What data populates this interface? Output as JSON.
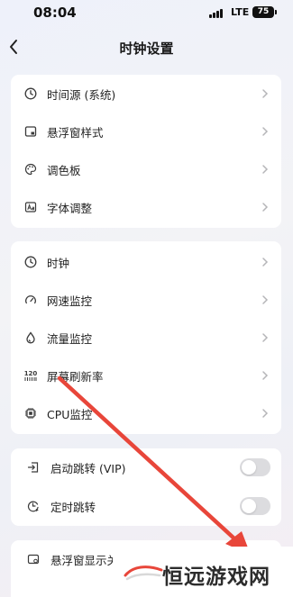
{
  "status_bar": {
    "time": "08:04",
    "network": "LTE",
    "battery": "75"
  },
  "header": {
    "title": "时钟设置"
  },
  "card1": {
    "items": [
      {
        "label": "时间源 (系统)",
        "icon": "clock-icon"
      },
      {
        "label": "悬浮窗样式",
        "icon": "window-icon"
      },
      {
        "label": "调色板",
        "icon": "palette-icon"
      },
      {
        "label": "字体调整",
        "icon": "font-icon"
      }
    ]
  },
  "card2": {
    "items": [
      {
        "label": "时钟",
        "icon": "clock-icon"
      },
      {
        "label": "网速监控",
        "icon": "speedometer-icon"
      },
      {
        "label": "流量监控",
        "icon": "droplet-icon"
      },
      {
        "label": "屏幕刷新率",
        "icon": "refresh-rate-icon",
        "icon_text": "120"
      },
      {
        "label": "CPU监控",
        "icon": "cpu-icon"
      }
    ]
  },
  "card3": {
    "items": [
      {
        "label": "启动跳转 (VIP)",
        "icon": "jump-icon",
        "enabled": false
      },
      {
        "label": "定时跳转",
        "icon": "timer-icon",
        "enabled": false
      }
    ]
  },
  "card4": {
    "items": [
      {
        "label": "悬浮窗显示关",
        "icon": "window-settings-icon"
      }
    ]
  },
  "watermark": {
    "text": "恒远游戏网"
  },
  "colors": {
    "arrow": "#e8463a",
    "toggle_off": "#dcdcdf",
    "icon": "#3a3a3a",
    "chevron": "#b5b5b8"
  }
}
